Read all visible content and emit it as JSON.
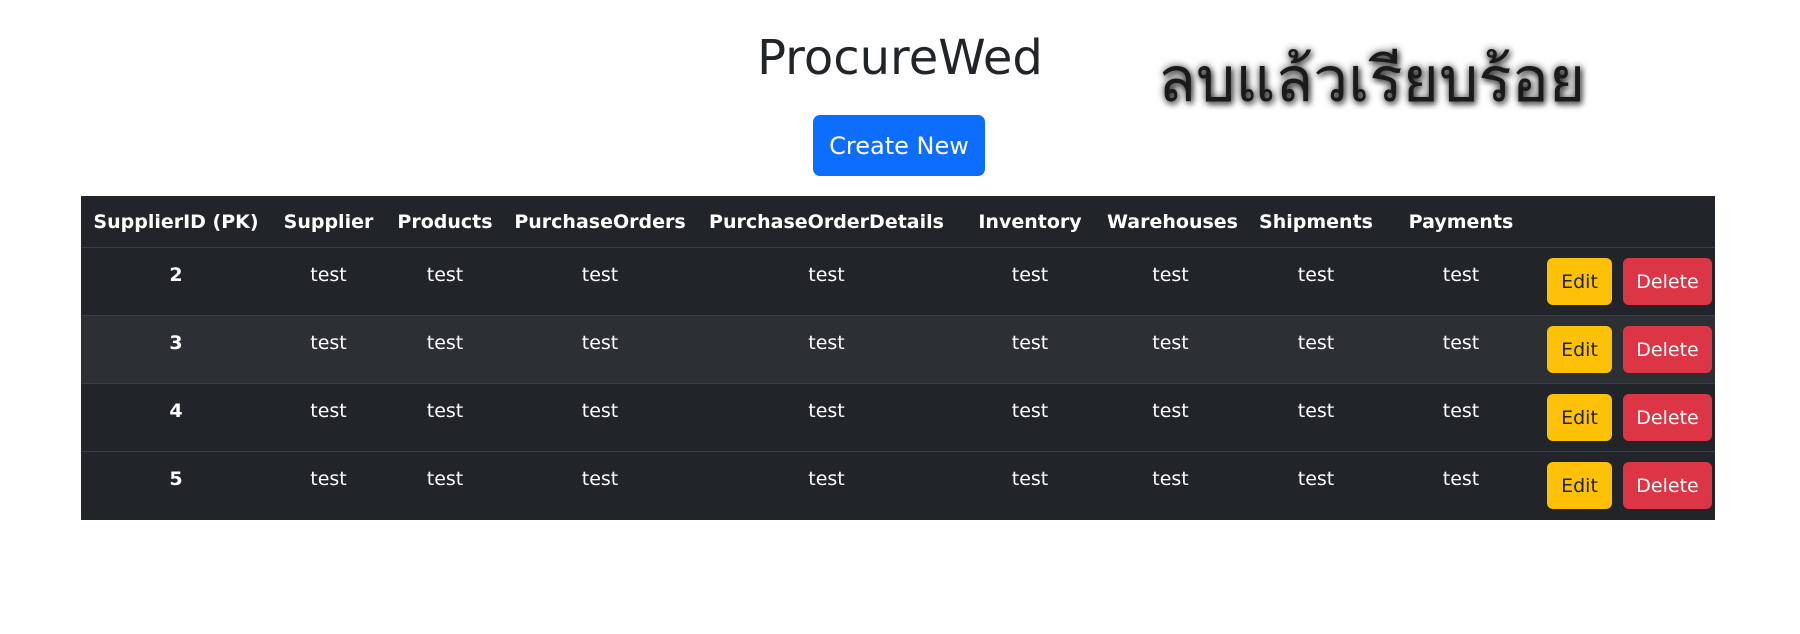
{
  "header": {
    "title": "ProcureWed",
    "notice": "ลบแล้วเรียบร้อย",
    "create_label": "Create New"
  },
  "table": {
    "columns": [
      "SupplierID (PK)",
      "Supplier",
      "Products",
      "PurchaseOrders",
      "PurchaseOrderDetails",
      "Inventory",
      "Warehouses",
      "Shipments",
      "Payments",
      ""
    ],
    "rows": [
      {
        "id": "2",
        "cells": [
          "test",
          "test",
          "test",
          "test",
          "test",
          "test",
          "test",
          "test"
        ]
      },
      {
        "id": "3",
        "cells": [
          "test",
          "test",
          "test",
          "test",
          "test",
          "test",
          "test",
          "test"
        ]
      },
      {
        "id": "4",
        "cells": [
          "test",
          "test",
          "test",
          "test",
          "test",
          "test",
          "test",
          "test"
        ]
      },
      {
        "id": "5",
        "cells": [
          "test",
          "test",
          "test",
          "test",
          "test",
          "test",
          "test",
          "test"
        ]
      }
    ],
    "edit_label": "Edit",
    "delete_label": "Delete"
  },
  "colors": {
    "primary": "#0d6efd",
    "warning": "#ffc107",
    "danger": "#dc3545",
    "table_dark": "#212529",
    "table_striped": "#2c3034"
  }
}
